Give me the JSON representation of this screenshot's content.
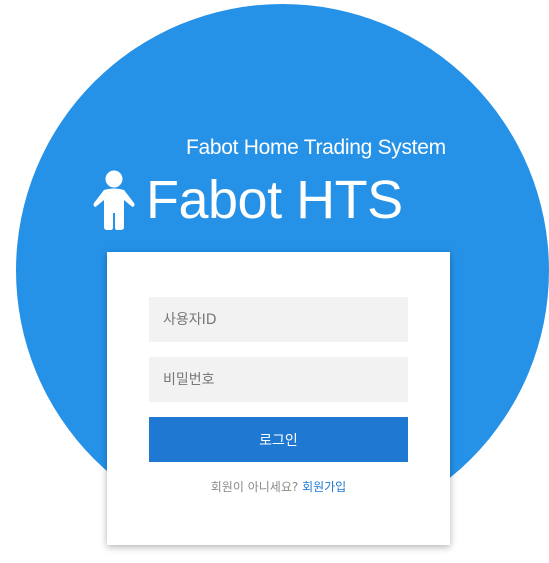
{
  "colors": {
    "circle": "#2592e8",
    "button": "#1f78d1",
    "field_bg": "#f2f2f2",
    "link": "#1f78d1"
  },
  "brand": {
    "subtitle": "Fabot Home Trading System",
    "title": "Fabot HTS",
    "icon": "person-icon"
  },
  "login_form": {
    "id_placeholder": "사용자ID",
    "id_value": "",
    "password_placeholder": "비밀번호",
    "password_value": "",
    "login_button": "로그인",
    "signup_prompt": "회원이 아니세요?",
    "signup_link": "회원가입"
  }
}
